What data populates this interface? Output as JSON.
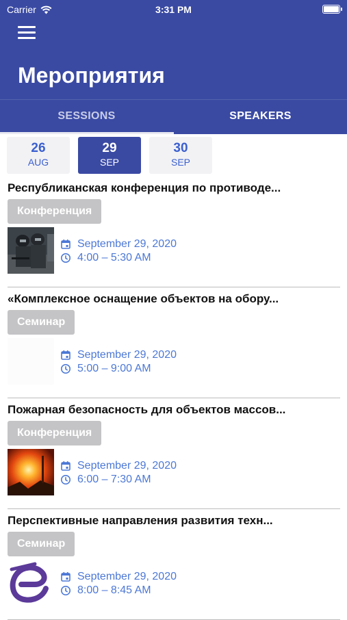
{
  "status": {
    "carrier": "Carrier",
    "time": "3:31 PM"
  },
  "header": {
    "title": "Мероприятия"
  },
  "tabs": [
    {
      "label": "SESSIONS"
    },
    {
      "label": "SPEAKERS"
    }
  ],
  "dates": [
    {
      "day": "26",
      "month": "AUG",
      "selected": false
    },
    {
      "day": "29",
      "month": "SEP",
      "selected": true
    },
    {
      "day": "30",
      "month": "SEP",
      "selected": false
    }
  ],
  "sessions": [
    {
      "title": "Республиканская конференция по противоде...",
      "badge": "Конференция",
      "date": "September 29, 2020",
      "time": "4:00 – 5:30 AM",
      "image": "soldiers-photo"
    },
    {
      "title": "«Комплексное оснащение объектов на обору...",
      "badge": "Семинар",
      "date": "September 29, 2020",
      "time": "5:00 – 9:00 AM",
      "image": "blank"
    },
    {
      "title": "Пожарная безопасность для объектов массов...",
      "badge": "Конференция",
      "date": "September 29, 2020",
      "time": "6:00 – 7:30 AM",
      "image": "fire-photo"
    },
    {
      "title": "Перспективные направления развития техн...",
      "badge": "Семинар",
      "date": "September 29, 2020",
      "time": "8:00 – 8:45 AM",
      "image": "e-logo"
    }
  ],
  "colors": {
    "primary": "#3a4aa3",
    "accent": "#4c78d6",
    "badge": "#c4c4c6"
  }
}
